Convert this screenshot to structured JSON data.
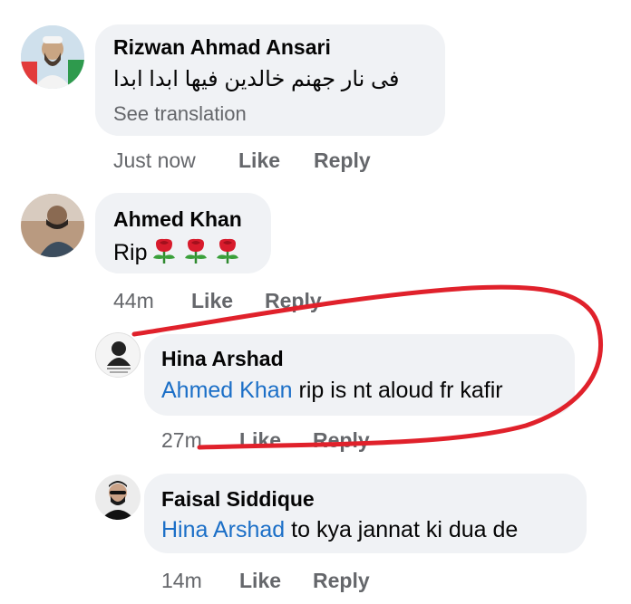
{
  "comments": [
    {
      "author": "Rizwan Ahmad Ansari",
      "text": "فی نار جھنم خالدین فیھا ابدا ابدا",
      "see_translation": "See translation",
      "time": "Just now",
      "like": "Like",
      "reply": "Reply"
    },
    {
      "author": "Ahmed Khan",
      "text": "Rip",
      "emoji": "rose-emoji",
      "emoji_count": 3,
      "time": "44m",
      "like": "Like",
      "reply": "Reply"
    },
    {
      "author": "Hina Arshad",
      "mention": "Ahmed Khan",
      "text": " rip is nt aloud fr kafir",
      "time": "27m",
      "like": "Like",
      "reply": "Reply"
    },
    {
      "author": "Faisal Siddique",
      "mention": "Hina Arshad",
      "text": " to kya jannat ki dua de",
      "time": "14m",
      "like": "Like",
      "reply": "Reply"
    }
  ],
  "colors": {
    "bubble": "#f0f2f5",
    "mention": "#1b6fc7",
    "meta": "#65676b",
    "annotation": "#e0212b"
  }
}
